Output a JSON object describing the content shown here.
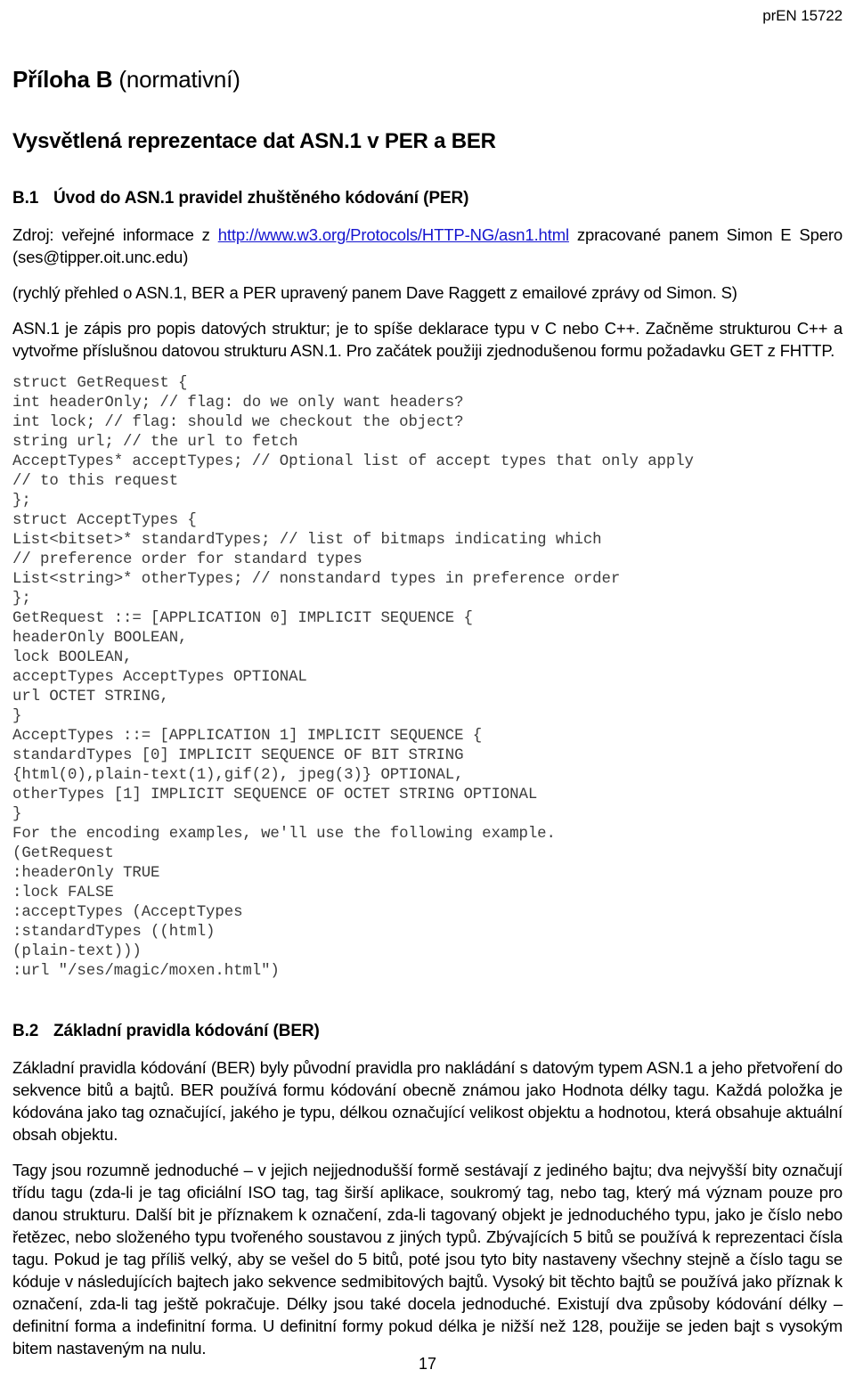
{
  "header": {
    "doc_number": "prEN 15722"
  },
  "annex": {
    "label": "Příloha B",
    "qualifier": " (normativní)",
    "subject_title": "Vysvětlená reprezentace dat ASN.1 v PER a BER"
  },
  "clauses": [
    {
      "number": "B.1",
      "title": "Úvod do ASN.1 pravidel zhuštěného kódování (PER)"
    },
    {
      "number": "B.2",
      "title": "Základní pravidla kódování (BER)"
    }
  ],
  "paragraphs": {
    "source_prefix": "Zdroj: veřejné informace z ",
    "source_link": "http://www.w3.org/Protocols/HTTP-NG/asn1.html",
    "source_suffix": " zpracované panem Simon E Spero (ses@tipper.oit.unc.edu)",
    "overview": "(rychlý přehled o ASN.1, BER a PER upravený panem Dave Raggett z emailové zprávy od Simon. S)",
    "asn1_intro": "ASN.1 je zápis pro popis datových struktur; je to spíše deklarace typu v C nebo C++. Začněme strukturou C++ a vytvořme příslušnou datovou strukturu ASN.1. Pro začátek použiji zjednodušenou formu požadavku GET z FHTTP.",
    "ber_intro": "Základní pravidla kódování (BER) byly původní pravidla pro nakládání s datovým typem ASN.1 a jeho přetvoření do sekvence bitů a bajtů. BER používá formu kódování obecně známou jako Hodnota délky tagu. Každá položka je kódována jako tag označující, jakého je typu, délkou označující velikost objektu a hodnotou, která obsahuje aktuální obsah objektu.",
    "tags_detail": "Tagy jsou rozumně jednoduché – v jejich nejjednodušší formě sestávají z jediného bajtu; dva nejvyšší bity označují třídu tagu (zda-li je tag oficiální ISO tag, tag širší aplikace, soukromý tag, nebo tag, který má význam pouze pro danou strukturu. Další bit je příznakem k označení, zda-li tagovaný objekt je jednoduchého typu, jako je číslo nebo řetězec, nebo složeného typu tvořeného soustavou z jiných typů. Zbývajících 5 bitů se používá k reprezentaci čísla tagu. Pokud je tag příliš velký, aby se vešel do 5 bitů, poté jsou tyto bity nastaveny všechny stejně a číslo tagu se kóduje v následujících bajtech jako sekvence sedmibitových bajtů. Vysoký bit těchto bajtů se používá jako příznak k označení, zda-li tag ještě pokračuje. Délky jsou také docela jednoduché. Existují dva způsoby kódování délky – definitní forma a indefinitní forma. U definitní formy pokud délka je nižší než 128, použije se jeden bajt s vysokým bitem nastaveným na nulu."
  },
  "code_listing": "struct GetRequest {\nint headerOnly; // flag: do we only want headers?\nint lock; // flag: should we checkout the object?\nstring url; // the url to fetch\nAcceptTypes* acceptTypes; // Optional list of accept types that only apply\n// to this request\n};\nstruct AcceptTypes {\nList<bitset>* standardTypes; // list of bitmaps indicating which\n// preference order for standard types\nList<string>* otherTypes; // nonstandard types in preference order\n};\nGetRequest ::= [APPLICATION 0] IMPLICIT SEQUENCE {\nheaderOnly BOOLEAN,\nlock BOOLEAN,\nacceptTypes AcceptTypes OPTIONAL\nurl OCTET STRING,\n}\nAcceptTypes ::= [APPLICATION 1] IMPLICIT SEQUENCE {\nstandardTypes [0] IMPLICIT SEQUENCE OF BIT STRING\n{html(0),plain-text(1),gif(2), jpeg(3)} OPTIONAL,\notherTypes [1] IMPLICIT SEQUENCE OF OCTET STRING OPTIONAL\n}\nFor the encoding examples, we'll use the following example.\n(GetRequest\n:headerOnly TRUE\n:lock FALSE\n:acceptTypes (AcceptTypes\n:standardTypes ((html)\n(plain-text)))\n:url \"/ses/magic/moxen.html\")",
  "footer": {
    "page_number": "17"
  },
  "colors": {
    "link": "#1515cf",
    "code_text": "#3b3b3b",
    "body_text": "#000000"
  }
}
